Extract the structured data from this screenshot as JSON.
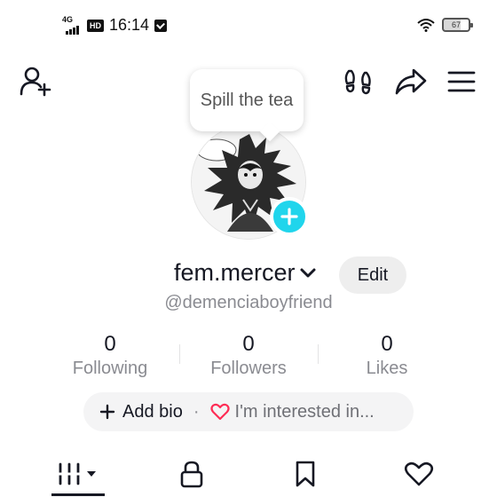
{
  "status_bar": {
    "network": "4G",
    "hd": "HD",
    "time": "16:14",
    "battery": "67"
  },
  "bubble": {
    "text": "Spill the tea"
  },
  "profile": {
    "username": "fem.mercer",
    "handle": "@demenciaboyfriend",
    "edit_label": "Edit"
  },
  "stats": [
    {
      "value": "0",
      "label": "Following"
    },
    {
      "value": "0",
      "label": "Followers"
    },
    {
      "value": "0",
      "label": "Likes"
    }
  ],
  "bio": {
    "add_bio": "Add bio",
    "separator": "·",
    "interest": "I'm interested in..."
  },
  "tabs": [
    "videos-grid",
    "private",
    "saved",
    "liked"
  ],
  "colors": {
    "accent": "#20d5ec",
    "heart": "#fe2c55",
    "secondary_text": "#8a8b91"
  }
}
